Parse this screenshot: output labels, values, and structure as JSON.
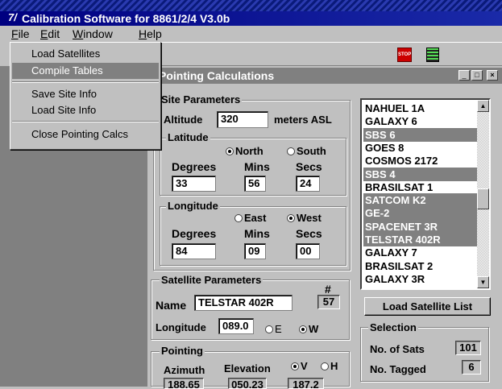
{
  "window": {
    "title": "Calibration Software for 8861/2/4  V3.0b",
    "app_icon": "7/"
  },
  "menu": {
    "file": "File",
    "edit": "Edit",
    "window": "Window",
    "help": "Help"
  },
  "file_menu": {
    "load_satellites": "Load Satellites",
    "compile_tables": "Compile Tables",
    "save_site_info": "Save Site Info",
    "load_site_info": "Load Site Info",
    "close_pointing_calcs": "Close Pointing Calcs"
  },
  "toolbar": {
    "stop_icon_text": "STOP"
  },
  "child_window": {
    "title": "Pointing Calculations"
  },
  "site": {
    "group": "Site Parameters",
    "altitude_label": "Altitude",
    "altitude_value": "320",
    "altitude_unit": "meters ASL",
    "latitude": {
      "group": "Latitude",
      "north": "North",
      "south": "South",
      "selected": "North",
      "degrees_label": "Degrees",
      "mins_label": "Mins",
      "secs_label": "Secs",
      "degrees": "33",
      "mins": "56",
      "secs": "24"
    },
    "longitude": {
      "group": "Longitude",
      "east": "East",
      "west": "West",
      "selected": "West",
      "degrees_label": "Degrees",
      "mins_label": "Mins",
      "secs_label": "Secs",
      "degrees": "84",
      "mins": "09",
      "secs": "00"
    }
  },
  "satellite": {
    "group": "Satellite Parameters",
    "number_label": "#",
    "number": "57",
    "name_label": "Name",
    "name": "TELSTAR 402R",
    "longitude_label": "Longitude",
    "longitude": "089.0",
    "e": "E",
    "w": "W",
    "selected": "W"
  },
  "pointing": {
    "group": "Pointing",
    "azimuth_label": "Azimuth",
    "elevation_label": "Elevation",
    "v": "V",
    "h": "H",
    "selected": "V",
    "azimuth": "188.65",
    "elevation": "050.23",
    "polarization": "187.2"
  },
  "satellite_list": {
    "items": [
      {
        "name": "NAHUEL 1A",
        "selected": false
      },
      {
        "name": "GALAXY 6",
        "selected": false
      },
      {
        "name": "SBS 6",
        "selected": true
      },
      {
        "name": "GOES 8",
        "selected": false
      },
      {
        "name": "COSMOS 2172",
        "selected": false
      },
      {
        "name": "SBS 4",
        "selected": true
      },
      {
        "name": "BRASILSAT 1",
        "selected": false
      },
      {
        "name": "SATCOM K2",
        "selected": true
      },
      {
        "name": "GE-2",
        "selected": true
      },
      {
        "name": "SPACENET 3R",
        "selected": true
      },
      {
        "name": "TELSTAR 402R",
        "selected": true
      },
      {
        "name": "GALAXY 7",
        "selected": false
      },
      {
        "name": "BRASILSAT 2",
        "selected": false
      },
      {
        "name": "GALAXY 3R",
        "selected": false
      }
    ],
    "load_button": "Load Satellite List"
  },
  "selection": {
    "group": "Selection",
    "num_sats_label": "No. of Sats",
    "num_sats": "101",
    "num_tagged_label": "No. Tagged",
    "num_tagged": "6"
  }
}
